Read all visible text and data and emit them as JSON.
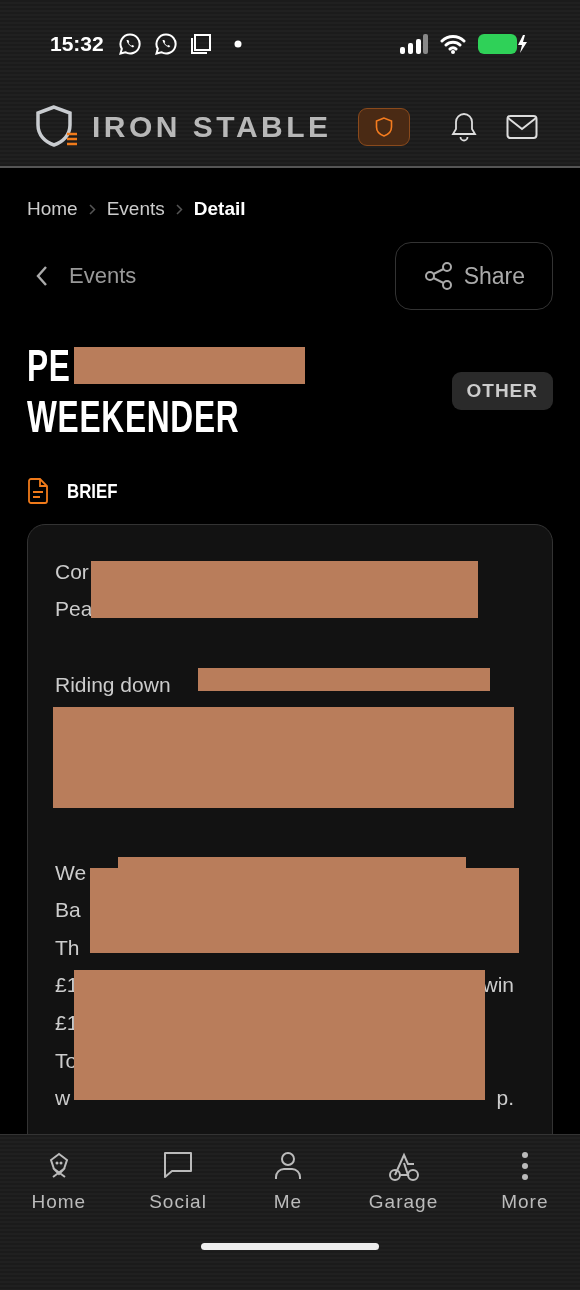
{
  "status_bar": {
    "time": "15:32"
  },
  "header": {
    "brand": "IRON STABLE"
  },
  "breadcrumb": [
    {
      "label": "Home",
      "current": false
    },
    {
      "label": "Events",
      "current": false
    },
    {
      "label": "Detail",
      "current": true
    }
  ],
  "back_link": {
    "label": "Events"
  },
  "share_button": {
    "label": "Share"
  },
  "event": {
    "title_lines": [
      "PE",
      "WEEKENDER"
    ],
    "tag": "OTHER"
  },
  "brief": {
    "heading": "BRIEF",
    "lines": [
      {
        "kind": "text",
        "parts": [
          "Cor"
        ]
      },
      {
        "kind": "text",
        "parts": [
          "Pea"
        ]
      },
      {
        "kind": "blank"
      },
      {
        "kind": "text",
        "parts": [
          "Riding down"
        ]
      },
      {
        "kind": "blank"
      },
      {
        "kind": "blank"
      },
      {
        "kind": "blank"
      },
      {
        "kind": "blank"
      },
      {
        "kind": "text",
        "parts": [
          "We"
        ]
      },
      {
        "kind": "text",
        "parts": [
          "Ba"
        ]
      },
      {
        "kind": "text",
        "parts": [
          "Th"
        ]
      },
      {
        "kind": "text",
        "parts": [
          "£1",
          "win"
        ]
      },
      {
        "kind": "text",
        "parts": [
          "£1"
        ]
      },
      {
        "kind": "text",
        "parts": [
          "To"
        ]
      },
      {
        "kind": "text",
        "parts": [
          "w",
          "p."
        ]
      }
    ]
  },
  "nav": [
    {
      "label": "Home",
      "selected": false
    },
    {
      "label": "Social",
      "selected": false
    },
    {
      "label": "Me",
      "selected": false
    },
    {
      "label": "Garage",
      "selected": false
    },
    {
      "label": "More",
      "selected": false
    }
  ]
}
